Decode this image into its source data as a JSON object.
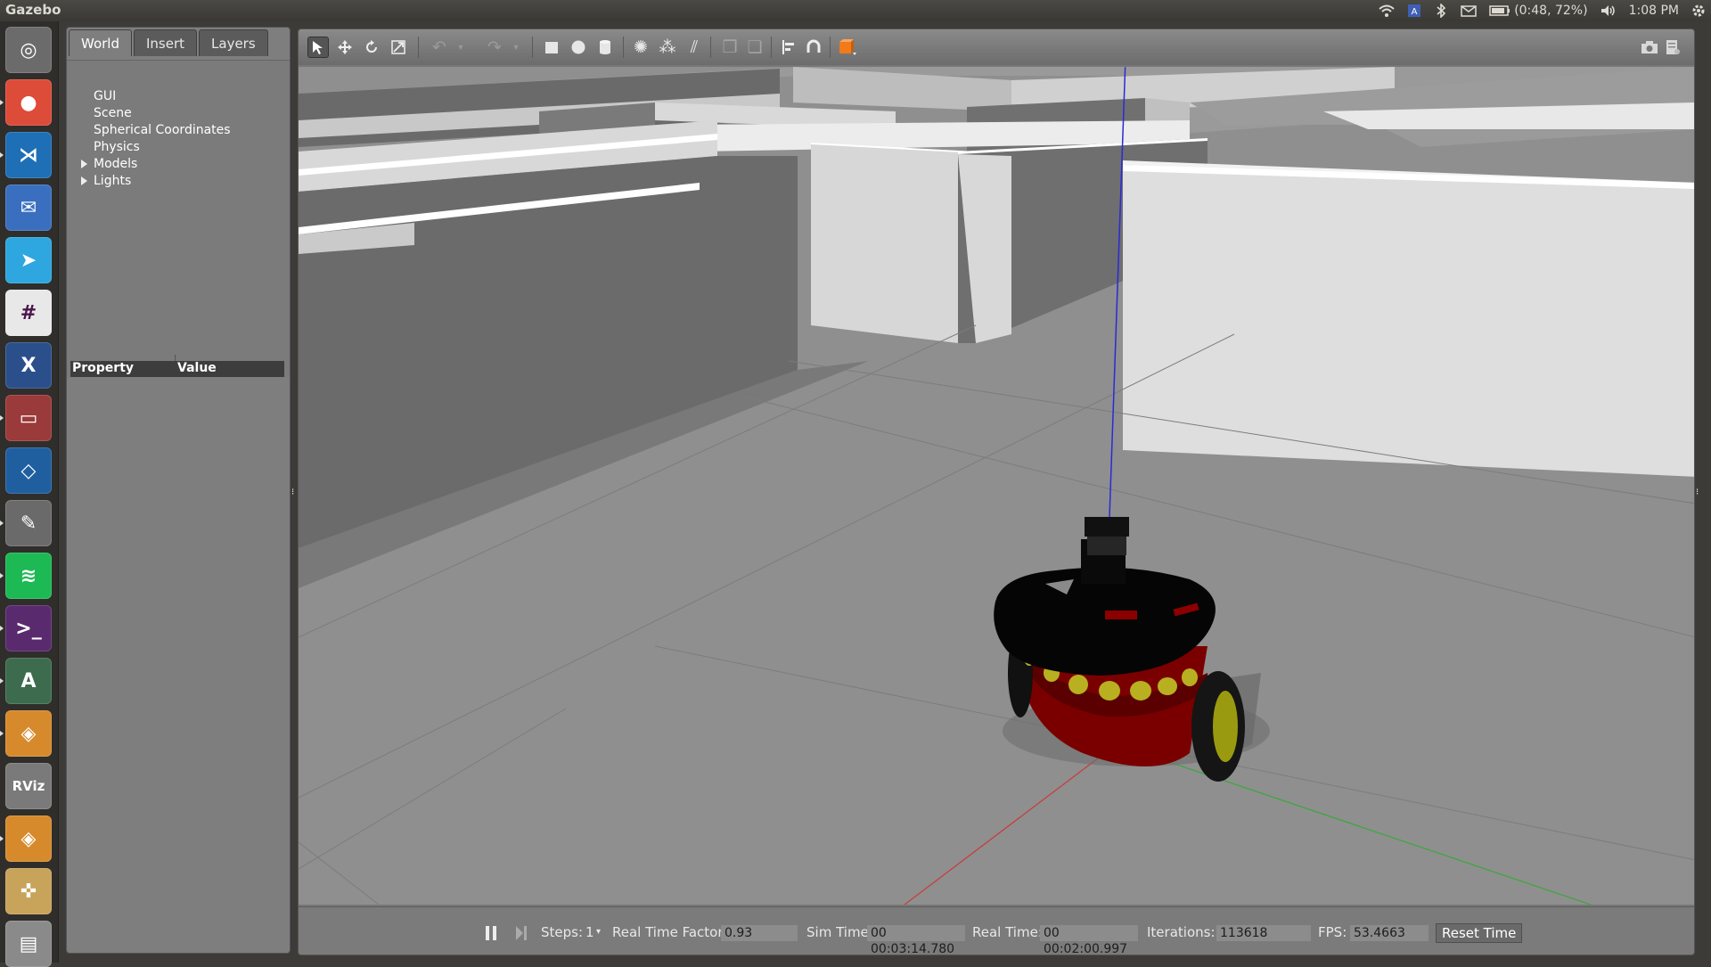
{
  "app": {
    "title": "Gazebo"
  },
  "topbar": {
    "battery": "(0:48, 72%)",
    "clock": "1:08 PM",
    "icons": [
      "wifi-icon",
      "keyboard-layout-icon",
      "bluetooth-icon",
      "mail-icon",
      "battery-icon",
      "volume-icon",
      "settings-gear-icon"
    ]
  },
  "launcher": {
    "apps": [
      {
        "name": "dash-home",
        "glyph": "◎",
        "color": "#6b6b6b"
      },
      {
        "name": "chrome",
        "glyph": "●",
        "color": "#dd4b39"
      },
      {
        "name": "vscode",
        "glyph": "⋊",
        "color": "#1e6fb5"
      },
      {
        "name": "thunderbird",
        "glyph": "✉",
        "color": "#3a6fbf"
      },
      {
        "name": "telegram",
        "glyph": "➤",
        "color": "#2ea6df"
      },
      {
        "name": "slack",
        "glyph": "#",
        "color": "#e8e8e8"
      },
      {
        "name": "xserver",
        "glyph": "X",
        "color": "#2b4f8a"
      },
      {
        "name": "files",
        "glyph": "▭",
        "color": "#9b3a3a"
      },
      {
        "name": "virtualbox",
        "glyph": "◇",
        "color": "#1f5fa0"
      },
      {
        "name": "system-settings",
        "glyph": "✎",
        "color": "#6a6a6a"
      },
      {
        "name": "spotify",
        "glyph": "≋",
        "color": "#1db954"
      },
      {
        "name": "terminal",
        "glyph": ">_",
        "color": "#5a2a6e"
      },
      {
        "name": "software-updater",
        "glyph": "A",
        "color": "#3d6b4e"
      },
      {
        "name": "gazebo",
        "glyph": "◈",
        "color": "#d68a2c"
      },
      {
        "name": "rviz",
        "glyph": "RViz",
        "color": "#7a7a7a"
      },
      {
        "name": "gazebo-2",
        "glyph": "◈",
        "color": "#d68a2c"
      },
      {
        "name": "joystick",
        "glyph": "✜",
        "color": "#c8a35a"
      },
      {
        "name": "trash",
        "glyph": "▤",
        "color": "#8a8a8a"
      }
    ]
  },
  "leftpanel": {
    "tabs": [
      "World",
      "Insert",
      "Layers"
    ],
    "tree": [
      {
        "label": "GUI",
        "expandable": false
      },
      {
        "label": "Scene",
        "expandable": false
      },
      {
        "label": "Spherical Coordinates",
        "expandable": false
      },
      {
        "label": "Physics",
        "expandable": false
      },
      {
        "label": "Models",
        "expandable": true
      },
      {
        "label": "Lights",
        "expandable": true
      }
    ],
    "property_header": "Property",
    "value_header": "Value"
  },
  "toolbar": {
    "tools": [
      "select-icon",
      "translate-icon",
      "rotate-icon",
      "scale-icon",
      "undo-icon",
      "redo-icon",
      "box-icon",
      "sphere-icon",
      "cylinder-icon",
      "point-light-icon",
      "spot-light-icon",
      "directional-light-icon",
      "copy-icon",
      "paste-icon",
      "align-icon",
      "snap-icon",
      "view-angle-icon"
    ],
    "right_tools": [
      "screenshot-icon",
      "log-icon"
    ]
  },
  "bottombar": {
    "steps_label": "Steps:",
    "steps_value": "1",
    "rtf_label": "Real Time Factor:",
    "rtf_value": "0.93",
    "sim_time_label": "Sim Time:",
    "sim_time_value": "00 00:03:14.780",
    "real_time_label": "Real Time:",
    "real_time_value": "00 00:02:00.997",
    "iterations_label": "Iterations:",
    "iterations_value": "113618",
    "fps_label": "FPS:",
    "fps_value": "53.4663",
    "reset_label": "Reset Time"
  }
}
